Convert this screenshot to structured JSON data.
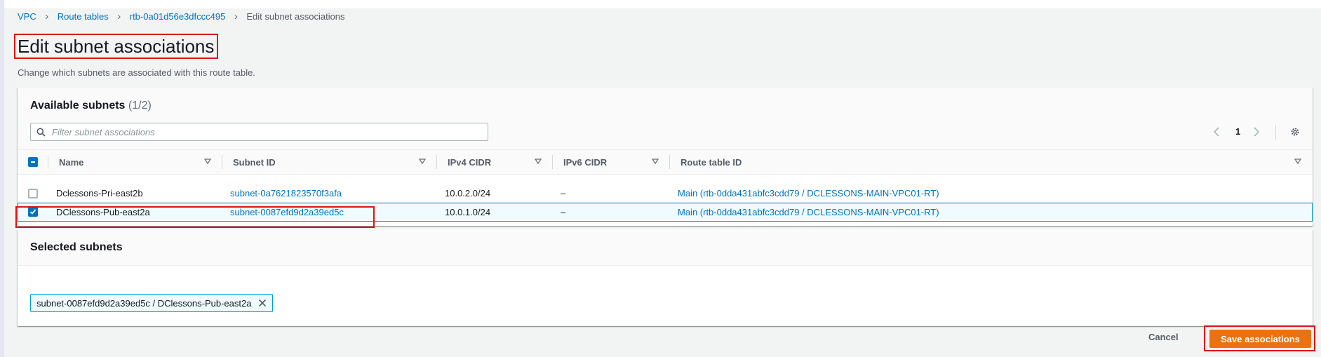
{
  "breadcrumbs": [
    {
      "label": "VPC"
    },
    {
      "label": "Route tables"
    },
    {
      "label": "rtb-0a01d56e3dfccc495"
    },
    {
      "label": "Edit subnet associations"
    }
  ],
  "page": {
    "title": "Edit subnet associations",
    "subtitle": "Change which subnets are associated with this route table."
  },
  "available_subnets": {
    "title": "Available subnets",
    "count": "(1/2)",
    "filter_placeholder": "Filter subnet associations",
    "page_number": "1",
    "columns": [
      "Name",
      "Subnet ID",
      "IPv4 CIDR",
      "IPv6 CIDR",
      "Route table ID"
    ],
    "rows": [
      {
        "selected": false,
        "name": "Dclessons-Pri-east2b",
        "subnet_id": "subnet-0a7621823570f3afa",
        "ipv4_cidr": "10.0.2.0/24",
        "ipv6_cidr": "–",
        "route_table_id": "Main (rtb-0dda431abfc3cdd79 / DCLESSONS-MAIN-VPC01-RT)"
      },
      {
        "selected": true,
        "name": "DClessons-Pub-east2a",
        "subnet_id": "subnet-0087efd9d2a39ed5c",
        "ipv4_cidr": "10.0.1.0/24",
        "ipv6_cidr": "–",
        "route_table_id": "Main (rtb-0dda431abfc3cdd79 / DCLESSONS-MAIN-VPC01-RT)"
      }
    ]
  },
  "selected_subnets": {
    "title": "Selected subnets",
    "tokens": [
      "subnet-0087efd9d2a39ed5c / DClessons-Pub-east2a"
    ]
  },
  "actions": {
    "cancel_label": "Cancel",
    "save_label": "Save associations"
  },
  "colors": {
    "link": "#0073bb",
    "primary_button": "#ec7211",
    "selection_border": "#00a1c9",
    "annotation_box": "#d91515"
  }
}
